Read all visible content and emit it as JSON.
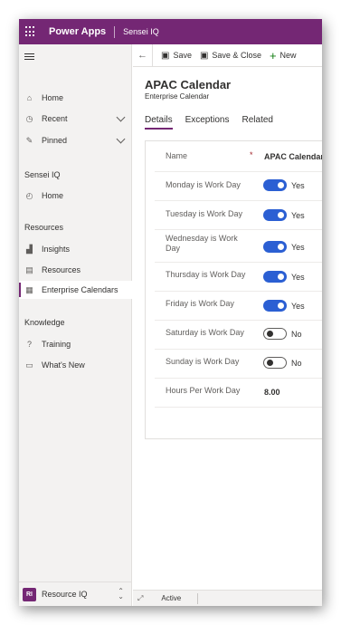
{
  "topbar": {
    "app_name": "Power Apps",
    "environment": "Sensei IQ"
  },
  "sidebar": {
    "top_items": [
      {
        "label": "Home",
        "icon": "home-icon"
      },
      {
        "label": "Recent",
        "icon": "clock-icon"
      },
      {
        "label": "Pinned",
        "icon": "pin-icon"
      }
    ],
    "sections": [
      {
        "title": "Sensei IQ",
        "items": [
          {
            "label": "Home",
            "icon": "dashboard-icon"
          }
        ]
      },
      {
        "title": "Resources",
        "items": [
          {
            "label": "Insights",
            "icon": "chart-icon"
          },
          {
            "label": "Resources",
            "icon": "resource-icon"
          },
          {
            "label": "Enterprise Calendars",
            "icon": "calendar-icon",
            "selected": true
          }
        ]
      },
      {
        "title": "Knowledge",
        "items": [
          {
            "label": "Training",
            "icon": "question-icon"
          },
          {
            "label": "What's New",
            "icon": "news-icon"
          }
        ]
      }
    ],
    "area": {
      "initials": "RI",
      "name": "Resource IQ"
    }
  },
  "commands": {
    "save": "Save",
    "save_close": "Save & Close",
    "new": "New"
  },
  "record": {
    "title": "APAC Calendar",
    "subtitle": "Enterprise Calendar",
    "tabs": [
      "Details",
      "Exceptions",
      "Related"
    ],
    "active_tab": "Details"
  },
  "form": {
    "name_label": "Name",
    "name_value": "APAC Calendar",
    "required_marker": "*",
    "days": [
      {
        "label": "Monday is Work Day",
        "on": true,
        "value": "Yes"
      },
      {
        "label": "Tuesday is Work Day",
        "on": true,
        "value": "Yes"
      },
      {
        "label": "Wednesday is Work Day",
        "on": true,
        "value": "Yes"
      },
      {
        "label": "Thursday is Work Day",
        "on": true,
        "value": "Yes"
      },
      {
        "label": "Friday is Work Day",
        "on": true,
        "value": "Yes"
      },
      {
        "label": "Saturday is Work Day",
        "on": false,
        "value": "No"
      },
      {
        "label": "Sunday is Work Day",
        "on": false,
        "value": "No"
      }
    ],
    "hours_label": "Hours Per Work Day",
    "hours_value": "8.00"
  },
  "status": {
    "text": "Active"
  },
  "colors": {
    "brand": "#742774",
    "toggle_on": "#2b5fd3",
    "required": "#a4262c"
  }
}
